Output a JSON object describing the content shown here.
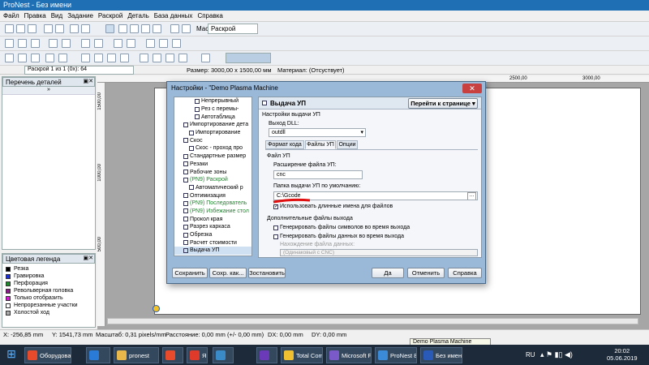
{
  "window": {
    "title": "ProNest - Без имени"
  },
  "menu": [
    "Файл",
    "Правка",
    "Вид",
    "Задание",
    "Раскрой",
    "Деталь",
    "База данных",
    "Справка"
  ],
  "toolbar": {
    "scale_label": "Масштаб:",
    "scale_value": "Раскрой"
  },
  "infobar": {
    "nest_selector": "Раскрой 1 из 1 (0x): 64",
    "size": "Размер: 3000,00 x 1500,00 мм",
    "material": "Материал: (Отсуствует)"
  },
  "ruler": {
    "top_ticks": [
      "2500,00",
      "3000,00"
    ],
    "left_ticks": [
      "1500,00",
      "1000,00",
      "500,00"
    ]
  },
  "parts_panel": {
    "title": "Перечень деталей"
  },
  "legend_panel": {
    "title": "Цветовая легенда",
    "items": [
      {
        "label": "Резка",
        "color": "#000000"
      },
      {
        "label": "Гравировка",
        "color": "#1a2fd6"
      },
      {
        "label": "Перфорация",
        "color": "#1a8a2a"
      },
      {
        "label": "Револьверная головка",
        "color": "#8a1a8a"
      },
      {
        "label": "Только отобразить",
        "color": "#d01ad0"
      },
      {
        "label": "Непрорезанные участки",
        "color": "#ffffff"
      },
      {
        "label": "Холостой ход",
        "color": "#aaaaaa"
      }
    ]
  },
  "dialog": {
    "title": "Настройки - \"Demo Plasma Machine",
    "close": "✕",
    "tree": [
      {
        "label": "Непрерывный",
        "indent": 3,
        "green": false
      },
      {
        "label": "Рез с перемы-",
        "indent": 3,
        "green": false
      },
      {
        "label": "Автотаблица",
        "indent": 3,
        "green": false
      },
      {
        "label": "Импортирование дета",
        "indent": 1,
        "green": false
      },
      {
        "label": "Импортирование",
        "indent": 2,
        "green": false
      },
      {
        "label": "Скос",
        "indent": 1,
        "green": false
      },
      {
        "label": "Скос - проход про",
        "indent": 2,
        "green": false
      },
      {
        "label": "Стандартные размер",
        "indent": 1,
        "green": false
      },
      {
        "label": "Резаки",
        "indent": 1,
        "green": false
      },
      {
        "label": "Рабочие зоны",
        "indent": 1,
        "green": false
      },
      {
        "label": "(PN9) Раскрой",
        "indent": 1,
        "green": true
      },
      {
        "label": "Автоматический р",
        "indent": 2,
        "green": false
      },
      {
        "label": "Оптимизация",
        "indent": 1,
        "green": false
      },
      {
        "label": "(PN9) Последователь",
        "indent": 1,
        "green": true
      },
      {
        "label": "(PN9) Избежание стол",
        "indent": 1,
        "green": true
      },
      {
        "label": "Прокол края",
        "indent": 1,
        "green": false
      },
      {
        "label": "Разрез каркаса",
        "indent": 1,
        "green": false
      },
      {
        "label": "Обрезка",
        "indent": 1,
        "green": false
      },
      {
        "label": "Расчет стоимости",
        "indent": 1,
        "green": false
      },
      {
        "label": "Выдача УП",
        "indent": 1,
        "green": false
      }
    ],
    "section_title": "Выдача УП",
    "goto_button": "Перейти к странице",
    "group1": "Настройки выдачи УП",
    "dll_label": "Выход DLL:",
    "dll_value": "outdll",
    "tabs": [
      "Формат кода",
      "Файлы УП",
      "Опции"
    ],
    "group2": "Файл УП",
    "ext_label": "Расширение файла УП:",
    "ext_value": "cnc",
    "folder_label": "Папка выдачи УП по умолчанию:",
    "folder_value": "C:\\Gcode",
    "longnames": "Использовать длинные имена для файлов",
    "group3": "Дополнительные файлы выхода",
    "gen_symbols": "Генерировать файлы символов во время выхода",
    "gen_data": "Генерировать файлы данных во время выхода",
    "data_location_label": "Нахождение файла данных:",
    "data_location_value": "(Одинаковый с CNC)",
    "buttons": {
      "save": "Сохранить",
      "save_as": "Сохр. как...",
      "restore": "Зостановить",
      "ok": "Да",
      "cancel": "Отменить",
      "help": "Справка"
    }
  },
  "status": {
    "x": "X: -256,85 mm",
    "y": "Y: 1541,73 mm",
    "scale": "Масштаб: 0,31 pixels/mm",
    "distance": "Расстояние: 0,00 mm (+/- 0,00 mm)",
    "dx": "DX: 0,00 mm",
    "dy": "DY: 0,00 mm"
  },
  "taskbar": {
    "tooltip": "Demo Plasma Machine",
    "items": [
      {
        "label": "Оборудова...",
        "color": "#e84a2c"
      },
      {
        "label": "",
        "color": "#2a7bd8"
      },
      {
        "label": "pronest",
        "color": "#e8b84a"
      },
      {
        "label": "",
        "color": "#e84a2c"
      },
      {
        "label": "Я",
        "color": "#e03a2a"
      },
      {
        "label": "",
        "color": "#3a8ac8"
      },
      {
        "label": "",
        "color": "#6a3ab8"
      },
      {
        "label": "Total Com...",
        "color": "#f0c030"
      },
      {
        "label": "Microsoft F...",
        "color": "#7a5ac8"
      },
      {
        "label": "ProNest 8",
        "color": "#3a8ad8"
      },
      {
        "label": "Без имени...",
        "color": "#2a5ab8"
      }
    ],
    "lang": "RU",
    "time": "20:02",
    "date": "05.06.2019"
  }
}
